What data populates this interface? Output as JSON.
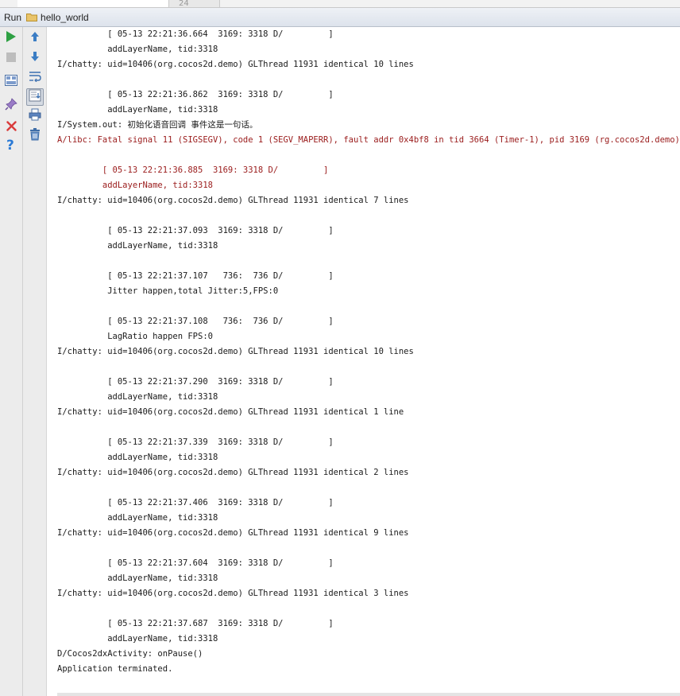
{
  "editor": {
    "line_number": "24"
  },
  "header": {
    "run_label": "Run",
    "config_name": "hello_world"
  },
  "toolbar": {
    "left": [
      "run-icon",
      "stop-icon",
      "restore-layout-icon",
      "pin-icon",
      "close-icon",
      "help-icon"
    ],
    "second": [
      "up-arrow-icon",
      "down-arrow-icon",
      "soft-wrap-icon",
      "scroll-to-end-icon",
      "print-icon",
      "trash-icon"
    ]
  },
  "colors": {
    "error_text": "#9a1b1b",
    "normal_text": "#1a1a1a",
    "run_green": "#2ea043",
    "close_red": "#d93b3b",
    "help_blue": "#2c7bd6"
  },
  "console": {
    "lines": [
      {
        "text": "          [ 05-13 22:21:36.664  3169: 3318 D/         ]",
        "type": "normal"
      },
      {
        "text": "          addLayerName, tid:3318",
        "type": "normal"
      },
      {
        "text": "I/chatty: uid=10406(org.cocos2d.demo) GLThread 11931 identical 10 lines",
        "type": "normal"
      },
      {
        "text": "",
        "type": "normal"
      },
      {
        "text": "          [ 05-13 22:21:36.862  3169: 3318 D/         ]",
        "type": "normal"
      },
      {
        "text": "          addLayerName, tid:3318",
        "type": "normal"
      },
      {
        "text": "I/System.out: 初始化语音回调 事件这是一句话。",
        "type": "normal"
      },
      {
        "text": "A/libc: Fatal signal 11 (SIGSEGV), code 1 (SEGV_MAPERR), fault addr 0x4bf8 in tid 3664 (Timer-1), pid 3169 (rg.cocos2d.demo)",
        "type": "error"
      },
      {
        "text": "",
        "type": "normal"
      },
      {
        "text": "         [ 05-13 22:21:36.885  3169: 3318 D/         ]",
        "type": "error"
      },
      {
        "text": "         addLayerName, tid:3318",
        "type": "error"
      },
      {
        "text": "I/chatty: uid=10406(org.cocos2d.demo) GLThread 11931 identical 7 lines",
        "type": "normal"
      },
      {
        "text": "",
        "type": "normal"
      },
      {
        "text": "          [ 05-13 22:21:37.093  3169: 3318 D/         ]",
        "type": "normal"
      },
      {
        "text": "          addLayerName, tid:3318",
        "type": "normal"
      },
      {
        "text": "",
        "type": "normal"
      },
      {
        "text": "          [ 05-13 22:21:37.107   736:  736 D/         ]",
        "type": "normal"
      },
      {
        "text": "          Jitter happen,total Jitter:5,FPS:0",
        "type": "normal"
      },
      {
        "text": "",
        "type": "normal"
      },
      {
        "text": "          [ 05-13 22:21:37.108   736:  736 D/         ]",
        "type": "normal"
      },
      {
        "text": "          LagRatio happen FPS:0",
        "type": "normal"
      },
      {
        "text": "I/chatty: uid=10406(org.cocos2d.demo) GLThread 11931 identical 10 lines",
        "type": "normal"
      },
      {
        "text": "",
        "type": "normal"
      },
      {
        "text": "          [ 05-13 22:21:37.290  3169: 3318 D/         ]",
        "type": "normal"
      },
      {
        "text": "          addLayerName, tid:3318",
        "type": "normal"
      },
      {
        "text": "I/chatty: uid=10406(org.cocos2d.demo) GLThread 11931 identical 1 line",
        "type": "normal"
      },
      {
        "text": "",
        "type": "normal"
      },
      {
        "text": "          [ 05-13 22:21:37.339  3169: 3318 D/         ]",
        "type": "normal"
      },
      {
        "text": "          addLayerName, tid:3318",
        "type": "normal"
      },
      {
        "text": "I/chatty: uid=10406(org.cocos2d.demo) GLThread 11931 identical 2 lines",
        "type": "normal"
      },
      {
        "text": "",
        "type": "normal"
      },
      {
        "text": "          [ 05-13 22:21:37.406  3169: 3318 D/         ]",
        "type": "normal"
      },
      {
        "text": "          addLayerName, tid:3318",
        "type": "normal"
      },
      {
        "text": "I/chatty: uid=10406(org.cocos2d.demo) GLThread 11931 identical 9 lines",
        "type": "normal"
      },
      {
        "text": "",
        "type": "normal"
      },
      {
        "text": "          [ 05-13 22:21:37.604  3169: 3318 D/         ]",
        "type": "normal"
      },
      {
        "text": "          addLayerName, tid:3318",
        "type": "normal"
      },
      {
        "text": "I/chatty: uid=10406(org.cocos2d.demo) GLThread 11931 identical 3 lines",
        "type": "normal"
      },
      {
        "text": "",
        "type": "normal"
      },
      {
        "text": "          [ 05-13 22:21:37.687  3169: 3318 D/         ]",
        "type": "normal"
      },
      {
        "text": "          addLayerName, tid:3318",
        "type": "normal"
      },
      {
        "text": "D/Cocos2dxActivity: onPause()",
        "type": "normal"
      },
      {
        "text": "Application terminated.",
        "type": "normal"
      }
    ]
  }
}
